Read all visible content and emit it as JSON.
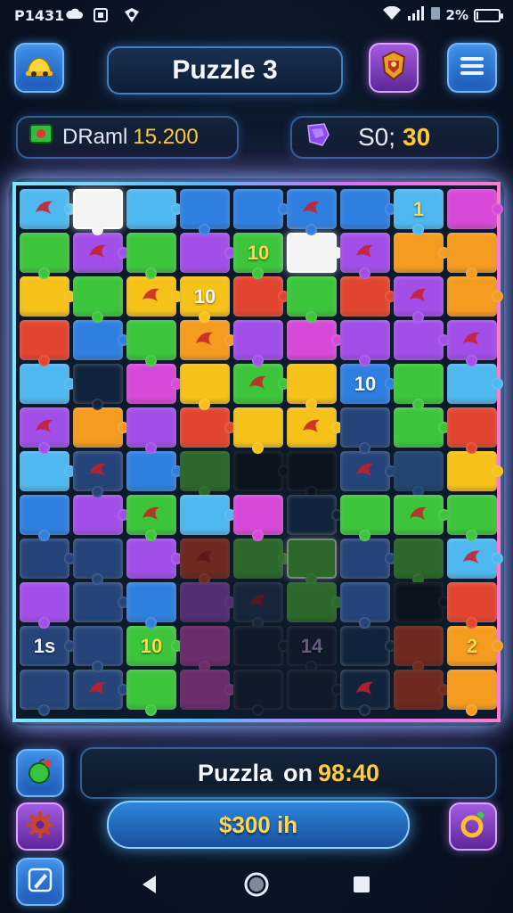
{
  "status": {
    "time": "P1431",
    "battery": "2%",
    "battery_level": 0.02,
    "icons": [
      "cloud-icon",
      "image-icon",
      "shield-icon",
      "wifi-icon",
      "signal-icon",
      "sim-icon",
      "battery-icon"
    ]
  },
  "header": {
    "title": "Puzzle 3",
    "left_icon": "home-helmet-icon",
    "crest_icon": "crest-icon",
    "menu_icon": "hamburger-menu-icon"
  },
  "stats": {
    "player_label": "DRaml 15.200",
    "player_name": "DRaml",
    "player_score": "15.200",
    "gems_value": "S0; 30",
    "gems_prefix": "S0;",
    "gems_count": "30"
  },
  "board": {
    "tile_labels": [
      "1",
      "10",
      "10",
      "10",
      "1s",
      "10",
      "14",
      "2"
    ]
  },
  "footer": {
    "timer_text": "Puzzla on 98:40",
    "timer_label": "Puzzla",
    "timer_on": "on",
    "timer_value": "98:40",
    "money": "$300 ih",
    "hint_icon": "hint-apple-icon",
    "settings_icon": "gear-icon",
    "ring_icon": "ring-icon",
    "edit_icon": "pencil-icon"
  },
  "colors": {
    "accent_blue": "#3c8fe8",
    "accent_purple": "#a35bdf",
    "gold": "#ffd84a",
    "board_glow_left": "#7fe6ff",
    "board_glow_right": "#ff7ad0"
  }
}
